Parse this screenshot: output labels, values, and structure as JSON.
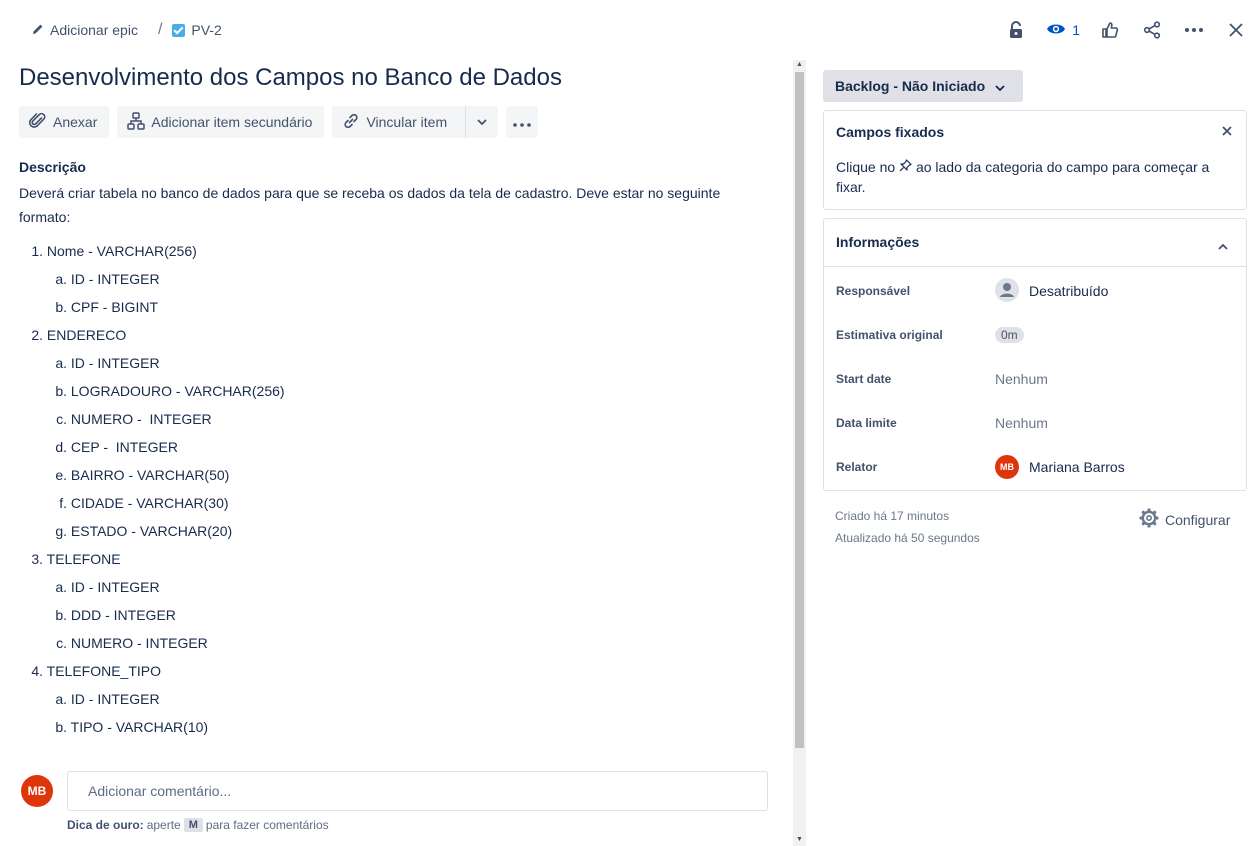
{
  "breadcrumb": {
    "add_epic": "Adicionar epic",
    "separator": "/",
    "issue_key": "PV-2"
  },
  "header_actions": {
    "watch_count": "1"
  },
  "issue": {
    "title": "Desenvolvimento dos Campos no Banco de Dados"
  },
  "toolbar": {
    "attach": "Anexar",
    "add_child": "Adicionar item secundário",
    "link": "Vincular item"
  },
  "description": {
    "heading": "Descrição",
    "text": "Deverá criar tabela no banco de dados para que se receba os dados da tela de cadastro. Deve estar no seguinte formato:",
    "items": [
      {
        "marker": "1.",
        "text": "Nome - VARCHAR(256)",
        "level": 1
      },
      {
        "marker": "a.",
        "text": "ID - INTEGER",
        "level": 2
      },
      {
        "marker": "b.",
        "text": "CPF - BIGINT",
        "level": 2
      },
      {
        "marker": "2.",
        "text": "ENDERECO",
        "level": 1
      },
      {
        "marker": "a.",
        "text": "ID - INTEGER",
        "level": 2
      },
      {
        "marker": "b.",
        "text": "LOGRADOURO - VARCHAR(256)",
        "level": 2
      },
      {
        "marker": "c.",
        "text": "NUMERO -  INTEGER",
        "level": 2
      },
      {
        "marker": "d.",
        "text": "CEP -  INTEGER",
        "level": 2
      },
      {
        "marker": "e.",
        "text": "BAIRRO - VARCHAR(50)",
        "level": 2
      },
      {
        "marker": "f.",
        "text": "CIDADE - VARCHAR(30)",
        "level": 2
      },
      {
        "marker": "g.",
        "text": "ESTADO - VARCHAR(20)",
        "level": 2
      },
      {
        "marker": "3.",
        "text": "TELEFONE",
        "level": 1
      },
      {
        "marker": "a.",
        "text": "ID - INTEGER",
        "level": 2
      },
      {
        "marker": "b.",
        "text": "DDD - INTEGER",
        "level": 2
      },
      {
        "marker": "c.",
        "text": "NUMERO - INTEGER",
        "level": 2
      },
      {
        "marker": "4.",
        "text": "TELEFONE_TIPO",
        "level": 1
      },
      {
        "marker": "a.",
        "text": "ID - INTEGER",
        "level": 2
      },
      {
        "marker": "b.",
        "text": "TIPO - VARCHAR(10)",
        "level": 2
      }
    ]
  },
  "comment": {
    "avatar_initials": "MB",
    "placeholder": "Adicionar comentário...",
    "tip_label": "Dica de ouro:",
    "tip_pre": "aperte",
    "tip_key": "M",
    "tip_post": "para fazer comentários"
  },
  "status": {
    "label": "Backlog - Não Iniciado"
  },
  "pinned": {
    "title": "Campos fixados",
    "text_pre": "Clique no",
    "text_post": "ao lado da categoria do campo para começar a fixar."
  },
  "info": {
    "title": "Informações",
    "fields": {
      "assignee": {
        "label": "Responsável",
        "value": "Desatribuído"
      },
      "estimate": {
        "label": "Estimativa original",
        "value": "0m"
      },
      "start": {
        "label": "Start date",
        "value": "Nenhum"
      },
      "due": {
        "label": "Data limite",
        "value": "Nenhum"
      },
      "reporter": {
        "label": "Relator",
        "value": "Mariana Barros",
        "initials": "MB"
      }
    }
  },
  "meta": {
    "created": "Criado há 17 minutos",
    "updated": "Atualizado há 50 segundos",
    "configure": "Configurar"
  },
  "colors": {
    "accent": "#0052cc",
    "avatar": "#de350b",
    "text": "#172b4d"
  }
}
